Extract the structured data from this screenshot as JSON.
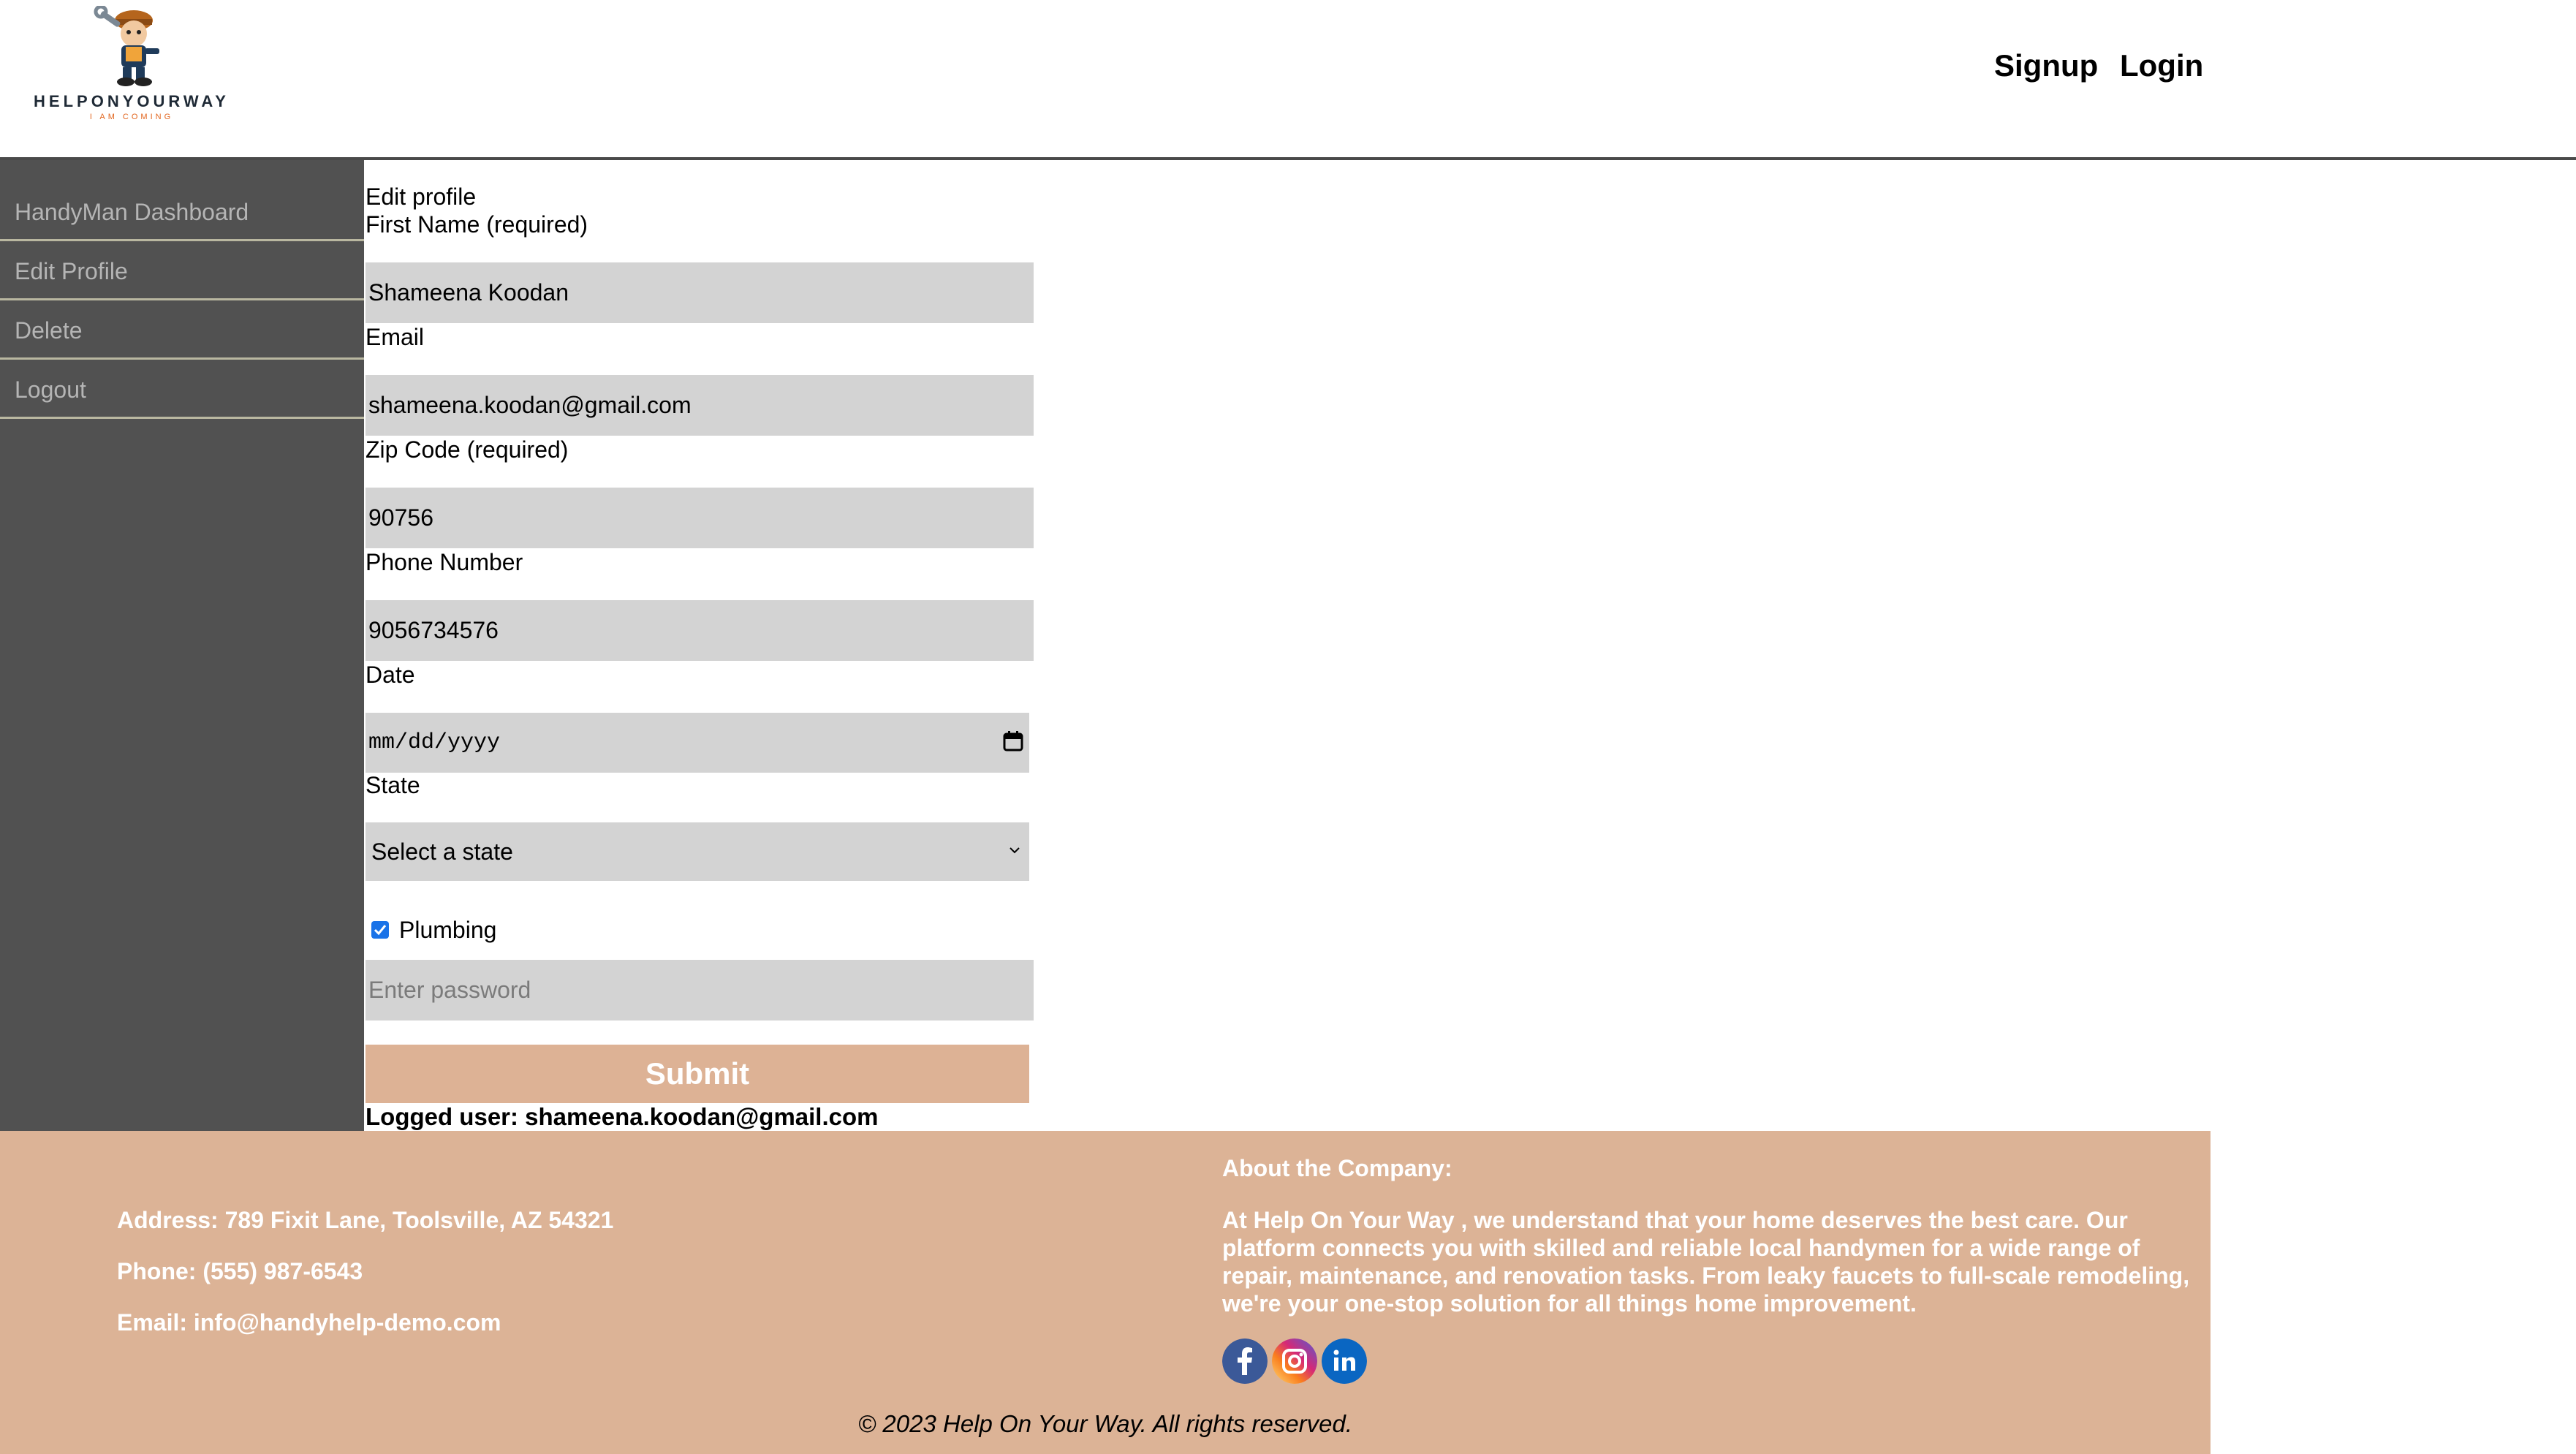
{
  "brand": {
    "name": "HELPONYOURWAY",
    "tagline": "I AM COMING"
  },
  "nav": {
    "signup": "Signup",
    "login": "Login"
  },
  "sidebar": {
    "items": [
      {
        "label": "HandyMan Dashboard"
      },
      {
        "label": "Edit Profile"
      },
      {
        "label": "Delete"
      },
      {
        "label": "Logout"
      }
    ]
  },
  "form": {
    "title": "Edit profile",
    "first_name": {
      "label": "First Name (required)",
      "value": "Shameena Koodan"
    },
    "email": {
      "label": "Email",
      "value": "shameena.koodan@gmail.com"
    },
    "zip": {
      "label": "Zip Code (required)",
      "value": "90756"
    },
    "phone": {
      "label": "Phone Number",
      "value": "9056734576"
    },
    "date": {
      "label": "Date",
      "placeholder": "mm/dd/yyyy"
    },
    "state": {
      "label": "State",
      "selected": "Select a state"
    },
    "service": {
      "label": "Plumbing",
      "checked": true
    },
    "password": {
      "placeholder": "Enter password"
    },
    "submit_label": "Submit",
    "logged_user": "Logged user: shameena.koodan@gmail.com"
  },
  "footer": {
    "address": "Address: 789 Fixit Lane, Toolsville, AZ 54321",
    "phone": "Phone: (555) 987-6543",
    "email": "Email: info@handyhelp-demo.com",
    "about_title": "About the Company:",
    "about_body": "At Help On Your Way , we understand that your home deserves the best care. Our platform connects you with skilled and reliable local handymen for a wide range of repair, maintenance, and renovation tasks. From leaky faucets to full-scale remodeling, we're your one-stop solution for all things home improvement.",
    "social": [
      "facebook-icon",
      "instagram-icon",
      "linkedin-icon"
    ],
    "copyright": "© 2023 Help On Your Way. All rights reserved."
  },
  "colors": {
    "sidebar_bg": "#515151",
    "accent": "#ddb295",
    "field_bg": "#d3d3d3"
  }
}
